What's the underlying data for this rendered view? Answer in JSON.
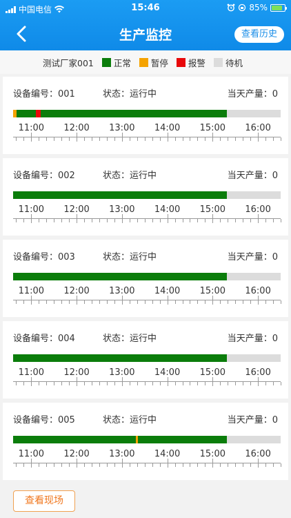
{
  "status_bar": {
    "carrier": "中国电信",
    "time": "15:46",
    "battery": "85%"
  },
  "header": {
    "title": "生产监控",
    "history_label": "查看历史"
  },
  "legend": {
    "vendor": "测试厂家001",
    "items": [
      {
        "label": "正常",
        "color": "#0b7d0b"
      },
      {
        "label": "暂停",
        "color": "#f5a300"
      },
      {
        "label": "报警",
        "color": "#e8080a"
      },
      {
        "label": "待机",
        "color": "#dcdcdc"
      }
    ]
  },
  "timeline": {
    "start_hour": 10.6,
    "end_hour": 16.5,
    "labels": [
      "11:00",
      "12:00",
      "13:00",
      "14:00",
      "15:00",
      "16:00"
    ],
    "label_hours": [
      11,
      12,
      13,
      14,
      15,
      16
    ]
  },
  "devices": [
    {
      "id_label": "设备编号：001",
      "status_label": "状态：运行中",
      "output_label": "当天产量：0",
      "segments": [
        {
          "start": 10.6,
          "end": 10.675,
          "state": "暂停"
        },
        {
          "start": 10.675,
          "end": 11.1,
          "state": "正常"
        },
        {
          "start": 11.1,
          "end": 11.21,
          "state": "报警"
        },
        {
          "start": 11.21,
          "end": 15.32,
          "state": "正常"
        }
      ]
    },
    {
      "id_label": "设备编号：002",
      "status_label": "状态：运行中",
      "output_label": "当天产量：0",
      "segments": [
        {
          "start": 10.6,
          "end": 15.32,
          "state": "正常"
        }
      ]
    },
    {
      "id_label": "设备编号：003",
      "status_label": "状态：运行中",
      "output_label": "当天产量：0",
      "segments": [
        {
          "start": 10.6,
          "end": 15.32,
          "state": "正常"
        }
      ]
    },
    {
      "id_label": "设备编号：004",
      "status_label": "状态：运行中",
      "output_label": "当天产量：0",
      "segments": [
        {
          "start": 10.6,
          "end": 15.32,
          "state": "正常"
        }
      ]
    },
    {
      "id_label": "设备编号：005",
      "status_label": "状态：运行中",
      "output_label": "当天产量：0",
      "segments": [
        {
          "start": 10.6,
          "end": 13.3,
          "state": "正常"
        },
        {
          "start": 13.3,
          "end": 13.35,
          "state": "暂停"
        },
        {
          "start": 13.35,
          "end": 15.32,
          "state": "正常"
        }
      ]
    }
  ],
  "footer": {
    "scene_label": "查看现场"
  }
}
